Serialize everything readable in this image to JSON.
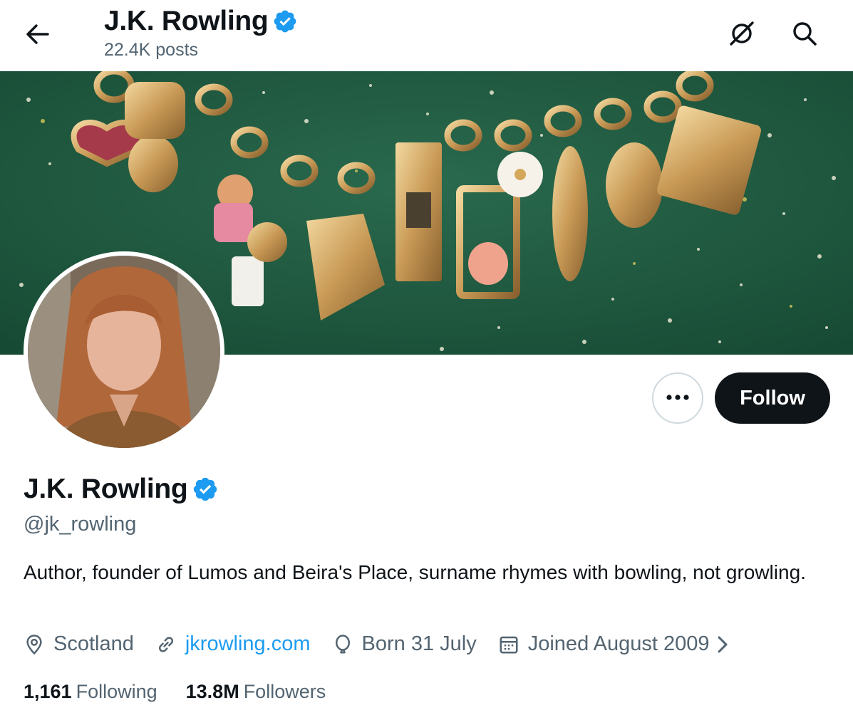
{
  "header": {
    "title": "J.K. Rowling",
    "posts_count": "22.4K posts"
  },
  "profile": {
    "name": "J.K. Rowling",
    "handle": "@jk_rowling",
    "bio": "Author, founder of Lumos and Beira's Place, surname rhymes with bowling, not growling.",
    "location": "Scotland",
    "website": "jkrowling.com",
    "birthday": "Born 31 July",
    "joined": "Joined August 2009",
    "following_count": "1,161",
    "following_label": "Following",
    "followers_count": "13.8M",
    "followers_label": "Followers",
    "verified": true
  },
  "actions": {
    "follow_label": "Follow"
  },
  "icons": {
    "back": "arrow-left-icon",
    "grok": "grok-icon",
    "search": "search-icon",
    "more": "more-dots-icon",
    "location": "location-pin-icon",
    "link": "link-icon",
    "birthday": "balloon-icon",
    "calendar": "calendar-icon",
    "chevron": "chevron-right-icon",
    "verified": "verified-badge-icon"
  },
  "colors": {
    "accent": "#1d9bf0",
    "text_primary": "#0f1419",
    "text_secondary": "#536471",
    "follow_bg": "#0f1419",
    "banner_bg": "#1f5a40"
  }
}
